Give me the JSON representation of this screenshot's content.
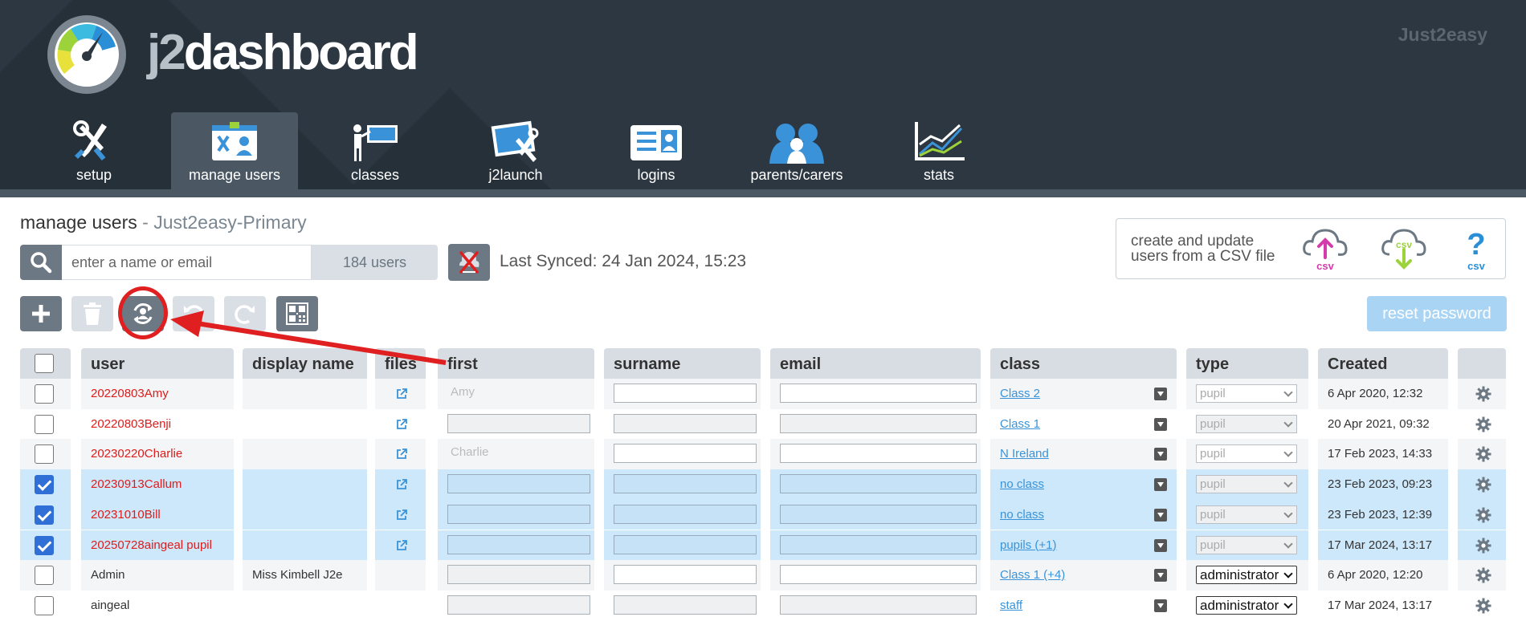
{
  "header": {
    "logo_prefix": "j2",
    "logo_suffix": "dashboard",
    "brand": "Just2easy"
  },
  "nav": {
    "items": [
      {
        "label": "setup",
        "icon": "tools-icon"
      },
      {
        "label": "manage users",
        "icon": "manage-users-icon"
      },
      {
        "label": "classes",
        "icon": "classroom-icon"
      },
      {
        "label": "j2launch",
        "icon": "j2launch-icon"
      },
      {
        "label": "logins",
        "icon": "login-card-icon"
      },
      {
        "label": "parents/carers",
        "icon": "parents-icon"
      },
      {
        "label": "stats",
        "icon": "stats-chart-icon"
      }
    ],
    "active": "manage users"
  },
  "page": {
    "title": "manage users",
    "separator": " - ",
    "school": "Just2easy-Primary"
  },
  "search": {
    "placeholder": "enter a name or email",
    "value": "",
    "count": "184 users"
  },
  "sync": {
    "text": "Last Synced: 24 Jan 2024, 15:23"
  },
  "csv": {
    "text": "create and update users from a CSV file",
    "icons": [
      "csv-upload-icon",
      "csv-download-icon",
      "csv-help-icon"
    ],
    "label": "csv"
  },
  "toolbar": {
    "buttons": [
      "add-icon",
      "delete-icon",
      "sync-user-icon",
      "undo-icon",
      "redo-icon",
      "qr-code-icon"
    ],
    "reset_password": "reset password"
  },
  "table": {
    "headers": [
      "user",
      "display name",
      "files",
      "first",
      "surname",
      "email",
      "class",
      "type",
      "Created"
    ],
    "rows": [
      {
        "user": "20220803Amy",
        "display": "",
        "first": "Amy",
        "cls": "Class 2",
        "type": "pupil",
        "created": "6 Apr 2020, 12:32",
        "checked": false,
        "red": true
      },
      {
        "user": "20220803Benji",
        "display": "",
        "first": "",
        "cls": "Class 1",
        "type": "pupil",
        "created": "20 Apr 2021, 09:32",
        "checked": false,
        "red": true
      },
      {
        "user": "20230220Charlie",
        "display": "",
        "first": "Charlie",
        "cls": "N Ireland",
        "type": "pupil",
        "created": "17 Feb 2023, 14:33",
        "checked": false,
        "red": true
      },
      {
        "user": "20230913Callum",
        "display": "",
        "first": "",
        "cls": "no class",
        "type": "pupil",
        "created": "23 Feb 2023, 09:23",
        "checked": true,
        "red": true
      },
      {
        "user": "20231010Bill",
        "display": "",
        "first": "",
        "cls": "no class",
        "type": "pupil",
        "created": "23 Feb 2023, 12:39",
        "checked": true,
        "red": true
      },
      {
        "user": "20250728aingeal pupil",
        "display": "",
        "first": "",
        "cls": "pupils (+1)",
        "type": "pupil",
        "created": "17 Mar 2024, 13:17",
        "checked": true,
        "red": true
      },
      {
        "user": "Admin",
        "display": "Miss Kimbell J2e",
        "first": "",
        "cls": "Class 1 (+4)",
        "type": "administrator",
        "created": "6 Apr 2020, 12:20",
        "checked": false,
        "red": false
      },
      {
        "user": "aingeal",
        "display": "",
        "first": "",
        "cls": "staff",
        "type": "administrator",
        "created": "17 Mar 2024, 13:17",
        "checked": false,
        "red": false
      }
    ]
  },
  "colors": {
    "header_bg": "#2d3742",
    "accent_blue": "#3a93d8",
    "selected_row": "#cde8fb",
    "highlight_red": "#e02020"
  }
}
